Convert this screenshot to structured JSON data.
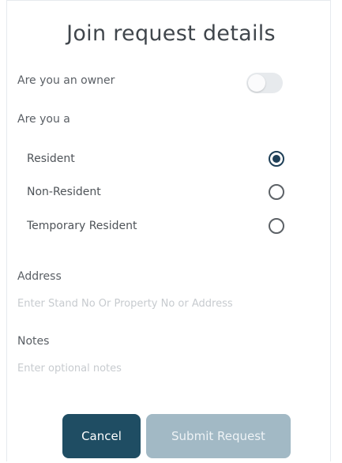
{
  "title": "Join request details",
  "owner": {
    "label": "Are you an owner",
    "toggle_on": false
  },
  "resident_type": {
    "label": "Are you a",
    "options": [
      {
        "label": "Resident",
        "selected": true
      },
      {
        "label": "Non-Resident",
        "selected": false
      },
      {
        "label": "Temporary Resident",
        "selected": false
      }
    ]
  },
  "address": {
    "label": "Address",
    "value": "",
    "placeholder": "Enter Stand No Or Property No or Address"
  },
  "notes": {
    "label": "Notes",
    "value": "",
    "placeholder": "Enter optional notes"
  },
  "buttons": {
    "cancel": "Cancel",
    "submit": "Submit Request"
  },
  "colors": {
    "primary": "#1f4d63",
    "disabled": "#a2b9c5",
    "radio_selected": "#1e3f57"
  }
}
